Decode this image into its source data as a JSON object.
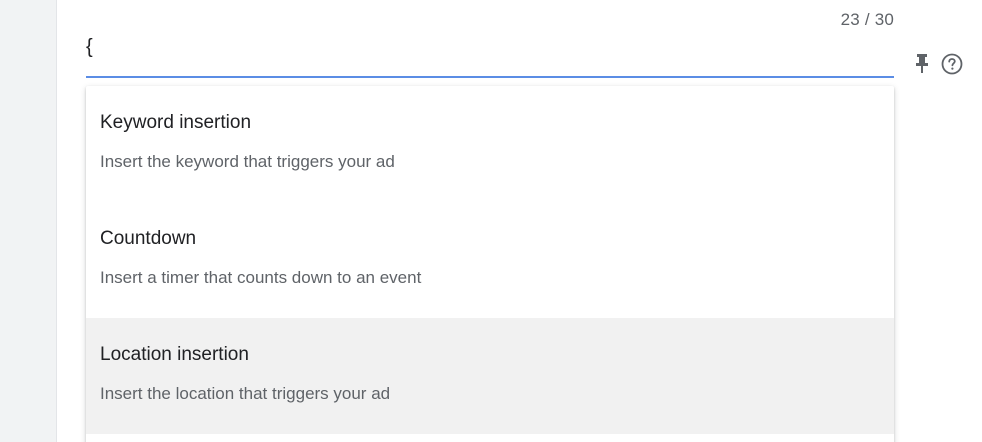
{
  "field": {
    "value": "{",
    "char_counter": "23 / 30"
  },
  "icons": {
    "pin": "pin-icon",
    "help": "help-circle-icon"
  },
  "colors": {
    "focus_underline": "#5b8de5",
    "active_row_bg": "#f1f1f1"
  },
  "menu": {
    "items": [
      {
        "title": "Keyword insertion",
        "description": "Insert the keyword that triggers your ad"
      },
      {
        "title": "Countdown",
        "description": "Insert a timer that counts down to an event"
      },
      {
        "title": "Location insertion",
        "description": "Insert the location that triggers your ad"
      }
    ],
    "active_index": 2
  }
}
